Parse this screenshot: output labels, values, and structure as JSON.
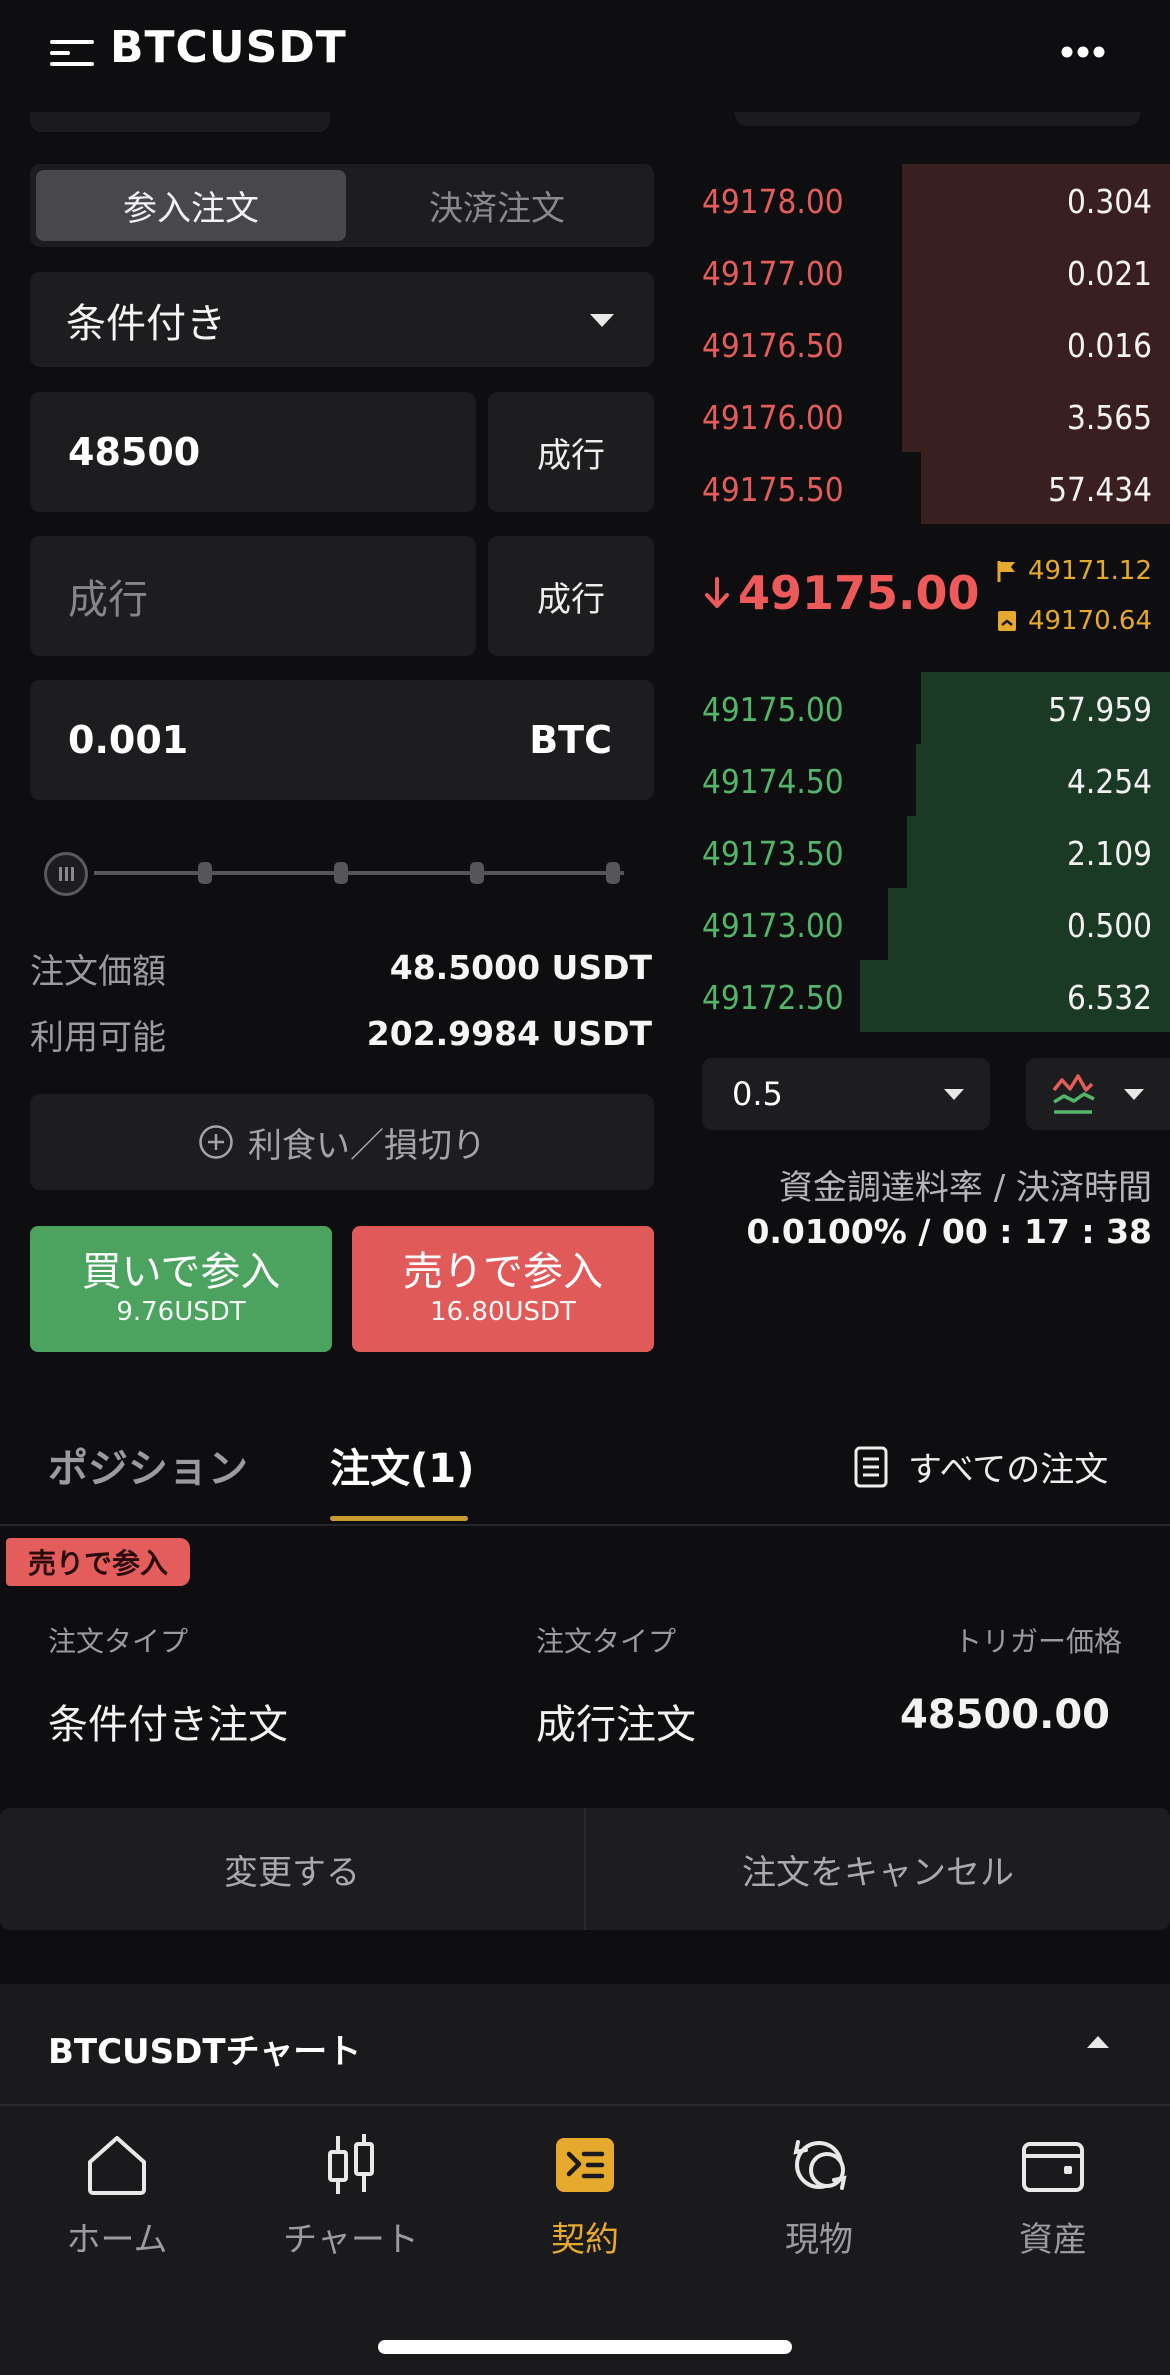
{
  "header": {
    "title": "BTCUSDT",
    "menu_icon": "menu-icon",
    "more_icon": "more-icon"
  },
  "order_form": {
    "tabs": [
      "参入注文",
      "決済注文"
    ],
    "order_type": "条件付き",
    "trigger_price": "48500",
    "trigger_market_btn": "成行",
    "price_placeholder": "成行",
    "price_market_btn": "成行",
    "quantity": "0.001",
    "quantity_unit": "BTC",
    "slider_percent": 0,
    "order_value_label": "注文価額",
    "order_value": "48.5000 USDT",
    "available_label": "利用可能",
    "available": "202.9984 USDT",
    "tpsl_label": "利食い／損切り",
    "buy_label": "買いで参入",
    "buy_sub": "9.76USDT",
    "sell_label": "売りで参入",
    "sell_sub": "16.80USDT"
  },
  "orderbook": {
    "asks": [
      {
        "price": "49178.00",
        "qty": "0.304",
        "depth": 0.57
      },
      {
        "price": "49177.00",
        "qty": "0.021",
        "depth": 0.57
      },
      {
        "price": "49176.50",
        "qty": "0.016",
        "depth": 0.57
      },
      {
        "price": "49176.00",
        "qty": "3.565",
        "depth": 0.57
      },
      {
        "price": "49175.50",
        "qty": "57.434",
        "depth": 0.53
      }
    ],
    "last_price": "49175.00",
    "mark_price": "49171.12",
    "index_price": "49170.64",
    "bids": [
      {
        "price": "49175.00",
        "qty": "57.959",
        "depth": 0.53
      },
      {
        "price": "49174.50",
        "qty": "4.254",
        "depth": 0.54
      },
      {
        "price": "49173.50",
        "qty": "2.109",
        "depth": 0.56
      },
      {
        "price": "49173.00",
        "qty": "0.500",
        "depth": 0.6
      },
      {
        "price": "49172.50",
        "qty": "6.532",
        "depth": 0.66
      }
    ],
    "depth_precision": "0.5",
    "funding_label": "資金調達料率 / 決済時間",
    "funding_value": "0.0100% / 00 : 17 : 38"
  },
  "tabs": {
    "positions": "ポジション",
    "orders": "注文(1)",
    "all_orders": "すべての注文"
  },
  "order_card": {
    "side_badge": "売りで参入",
    "col1_label": "注文タイプ",
    "col1_value": "条件付き注文",
    "col2_label": "注文タイプ",
    "col2_value": "成行注文",
    "col3_label": "トリガー価格",
    "col3_value": "48500.00",
    "modify_btn": "変更する",
    "cancel_btn": "注文をキャンセル"
  },
  "chart_section": {
    "title": "BTCUSDTチャート"
  },
  "bottom_nav": [
    {
      "label": "ホーム",
      "icon": "home-icon"
    },
    {
      "label": "チャート",
      "icon": "candlestick-icon"
    },
    {
      "label": "契約",
      "icon": "contract-icon",
      "active": true
    },
    {
      "label": "現物",
      "icon": "spot-icon"
    },
    {
      "label": "資産",
      "icon": "wallet-icon"
    }
  ],
  "colors": {
    "buy": "#4ba35f",
    "sell": "#e05a5a",
    "accent": "#e5a92e",
    "bg": "#0e0e10"
  }
}
